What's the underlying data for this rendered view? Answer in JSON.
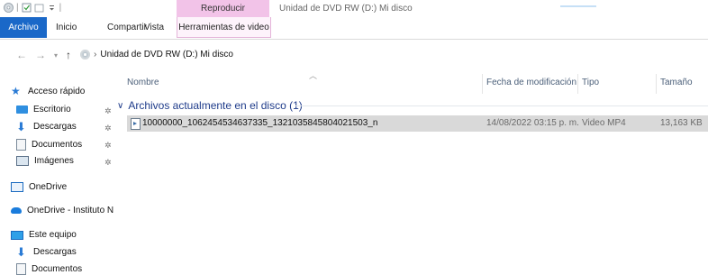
{
  "titlebar": {
    "context_tab": "Reproducir",
    "window_title": "Unidad de DVD RW (D:) Mi disco"
  },
  "ribbon": {
    "tabs": [
      "Archivo",
      "Inicio",
      "Compartir",
      "Vista",
      "Herramientas de video"
    ]
  },
  "address": {
    "path": "Unidad de DVD RW (D:) Mi disco"
  },
  "navpane": {
    "quick_access": "Acceso rápido",
    "items": [
      "Escritorio",
      "Descargas",
      "Documentos",
      "Imágenes"
    ],
    "onedrive": "OneDrive",
    "onedrive_inst": "OneDrive - Instituto N",
    "this_pc": "Este equipo",
    "pc_items": [
      "Descargas",
      "Documentos"
    ]
  },
  "columns": {
    "name": "Nombre",
    "date": "Fecha de modificación",
    "type": "Tipo",
    "size": "Tamaño"
  },
  "group": {
    "label": "Archivos actualmente en el disco (1)"
  },
  "files": [
    {
      "name": "10000000_1062454534637335_1321035845804021503_n",
      "date": "14/08/2022 03:15 p. m.",
      "type": "Video MP4",
      "size": "13,163 KB"
    }
  ]
}
